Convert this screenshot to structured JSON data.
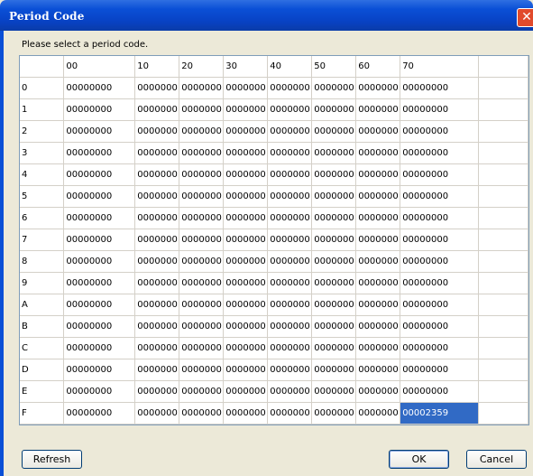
{
  "window": {
    "title": "Period Code",
    "close_symbol": "✕"
  },
  "prompt": "Please select a period code.",
  "table": {
    "columns": [
      "",
      "00",
      "10",
      "20",
      "30",
      "40",
      "50",
      "60",
      "70"
    ],
    "rows": [
      [
        "0",
        "00000000",
        "0000000",
        "0000000",
        "0000000",
        "0000000",
        "0000000",
        "0000000",
        "00000000"
      ],
      [
        "1",
        "00000000",
        "0000000",
        "0000000",
        "0000000",
        "0000000",
        "0000000",
        "0000000",
        "00000000"
      ],
      [
        "2",
        "00000000",
        "0000000",
        "0000000",
        "0000000",
        "0000000",
        "0000000",
        "0000000",
        "00000000"
      ],
      [
        "3",
        "00000000",
        "0000000",
        "0000000",
        "0000000",
        "0000000",
        "0000000",
        "0000000",
        "00000000"
      ],
      [
        "4",
        "00000000",
        "0000000",
        "0000000",
        "0000000",
        "0000000",
        "0000000",
        "0000000",
        "00000000"
      ],
      [
        "5",
        "00000000",
        "0000000",
        "0000000",
        "0000000",
        "0000000",
        "0000000",
        "0000000",
        "00000000"
      ],
      [
        "6",
        "00000000",
        "0000000",
        "0000000",
        "0000000",
        "0000000",
        "0000000",
        "0000000",
        "00000000"
      ],
      [
        "7",
        "00000000",
        "0000000",
        "0000000",
        "0000000",
        "0000000",
        "0000000",
        "0000000",
        "00000000"
      ],
      [
        "8",
        "00000000",
        "0000000",
        "0000000",
        "0000000",
        "0000000",
        "0000000",
        "0000000",
        "00000000"
      ],
      [
        "9",
        "00000000",
        "0000000",
        "0000000",
        "0000000",
        "0000000",
        "0000000",
        "0000000",
        "00000000"
      ],
      [
        "A",
        "00000000",
        "0000000",
        "0000000",
        "0000000",
        "0000000",
        "0000000",
        "0000000",
        "00000000"
      ],
      [
        "B",
        "00000000",
        "0000000",
        "0000000",
        "0000000",
        "0000000",
        "0000000",
        "0000000",
        "00000000"
      ],
      [
        "C",
        "00000000",
        "0000000",
        "0000000",
        "0000000",
        "0000000",
        "0000000",
        "0000000",
        "00000000"
      ],
      [
        "D",
        "00000000",
        "0000000",
        "0000000",
        "0000000",
        "0000000",
        "0000000",
        "0000000",
        "00000000"
      ],
      [
        "E",
        "00000000",
        "0000000",
        "0000000",
        "0000000",
        "0000000",
        "0000000",
        "0000000",
        "00000000"
      ],
      [
        "F",
        "00000000",
        "0000000",
        "0000000",
        "0000000",
        "0000000",
        "0000000",
        "0000000",
        "00002359"
      ]
    ],
    "selected_cell": {
      "row": 15,
      "col": 8
    }
  },
  "buttons": {
    "refresh": "Refresh",
    "ok": "OK",
    "cancel": "Cancel"
  }
}
